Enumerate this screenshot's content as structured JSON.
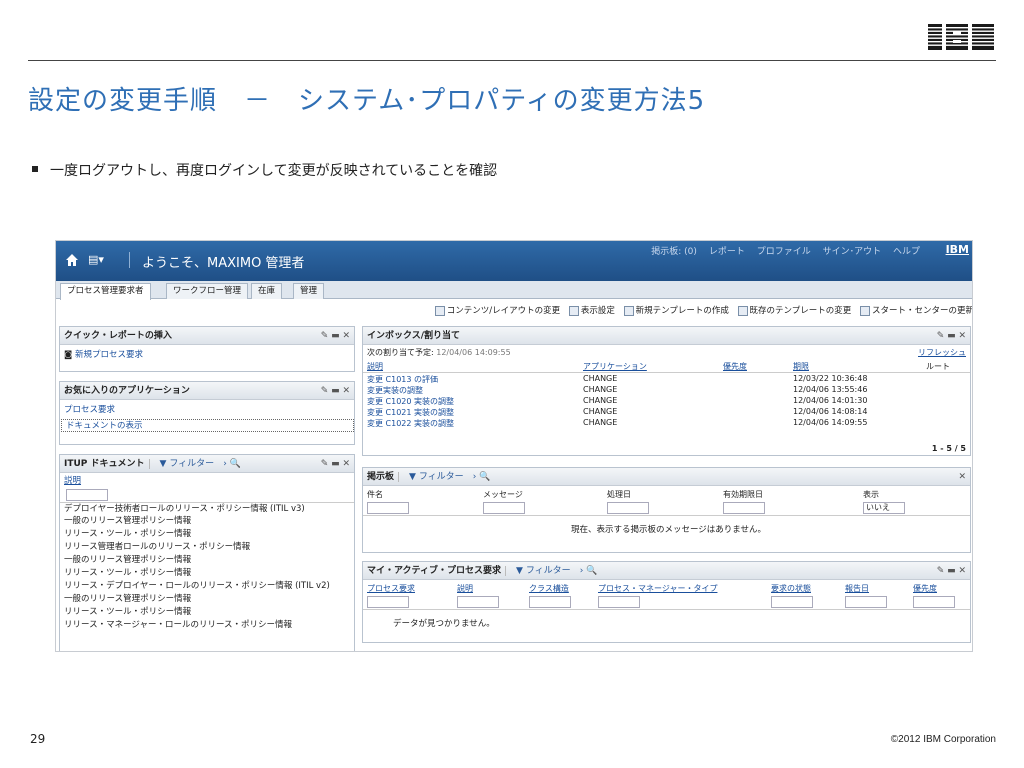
{
  "slide": {
    "logo": "IBM",
    "title": "設定の変更手順　－　システム･プロパティの変更方法5",
    "bullet": "一度ログアウトし、再度ログインして変更が反映されていることを確認",
    "page_number": "29",
    "copyright": "©2012 IBM Corporation"
  },
  "app": {
    "welcome": "ようこそ、MAXIMO 管理者",
    "top_links": [
      "掲示板: (0)",
      "レポート",
      "プロファイル",
      "サイン･アウト",
      "ヘルプ"
    ],
    "mini_logo": "IBM",
    "tabs": [
      "プロセス管理要求者",
      "ワークフロー管理",
      "在庫",
      "管理"
    ],
    "toolbar": [
      "コンテンツ/レイアウトの変更",
      "表示設定",
      "新規テンプレートの作成",
      "既存のテンプレートの変更",
      "スタート・センターの更新"
    ],
    "quick_report": {
      "title": "クイック・レポートの挿入",
      "item": "新規プロセス要求"
    },
    "favorites": {
      "title": "お気に入りのアプリケーション",
      "items": [
        "プロセス要求",
        "ドキュメントの表示"
      ]
    },
    "itup": {
      "title": "ITUP ドキュメント",
      "filter": "フィルター",
      "column": "説明",
      "rows": [
        "デプロイヤー技術者ロールのリリース・ポリシー情報 (ITIL v3)",
        "一般のリリース管理ポリシー情報",
        "リリース・ツール・ポリシー情報",
        "リリース管理者ロールのリリース・ポリシー情報",
        "一般のリリース管理ポリシー情報",
        "リリース・ツール・ポリシー情報",
        "リリース・デプロイヤー・ロールのリリース・ポリシー情報 (ITIL v2)",
        "一般のリリース管理ポリシー情報",
        "リリース・ツール・ポリシー情報",
        "リリース・マネージャー・ロールのリリース・ポリシー情報"
      ]
    },
    "inbox": {
      "title": "インボックス/割り当て",
      "next_label": "次の割り当て予定:",
      "next_value": "12/04/06 14:09:55",
      "refresh": "リフレッシュ",
      "columns": [
        "説明",
        "アプリケーション",
        "優先度",
        "期限",
        "ルート"
      ],
      "rows": [
        {
          "desc": "変更 C1013 の評価",
          "app": "CHANGE",
          "due": "12/03/22 10:36:48"
        },
        {
          "desc": "変更実装の調整",
          "app": "CHANGE",
          "due": "12/04/06 13:55:46"
        },
        {
          "desc": "変更 C1020 実装の調整",
          "app": "CHANGE",
          "due": "12/04/06 14:01:30"
        },
        {
          "desc": "変更 C1021 実装の調整",
          "app": "CHANGE",
          "due": "12/04/06 14:08:14"
        },
        {
          "desc": "変更 C1022 実装の調整",
          "app": "CHANGE",
          "due": "12/04/06 14:09:55"
        }
      ],
      "pager": "1 - 5 / 5"
    },
    "bulletin": {
      "title": "掲示板",
      "filter": "フィルター",
      "columns": [
        "件名",
        "メッセージ",
        "処理日",
        "有効期限日",
        "表示"
      ],
      "display_value": "いいえ",
      "empty": "現在、表示する掲示板のメッセージはありません。"
    },
    "active": {
      "title": "マイ・アクティブ・プロセス要求",
      "filter": "フィルター",
      "columns": [
        "プロセス要求",
        "説明",
        "クラス構造",
        "プロセス・マネージャー・タイプ",
        "要求の状態",
        "報告日",
        "優先度"
      ],
      "empty": "データが見つかりません。"
    }
  }
}
